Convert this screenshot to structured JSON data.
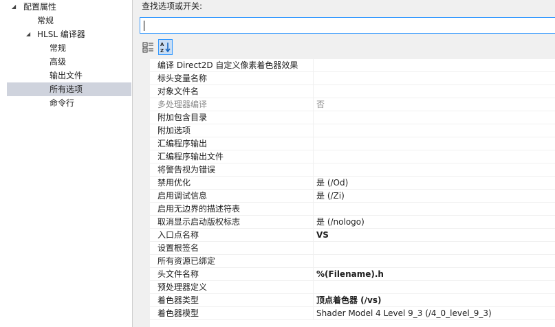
{
  "tree": {
    "items": [
      {
        "label": "配置属性",
        "arrow": "◢"
      },
      {
        "label": "常规"
      },
      {
        "label": "HLSL 编译器",
        "arrow": "◢"
      },
      {
        "label": "常规"
      },
      {
        "label": "高级"
      },
      {
        "label": "输出文件"
      },
      {
        "label": "所有选项",
        "selected": true
      },
      {
        "label": "命令行"
      }
    ]
  },
  "search": {
    "label": "查找选项或开关:",
    "value": ""
  },
  "toolbar": {
    "categorized_icon": "categorized-view-icon",
    "alphabetical_icon": "sort-alphabetical-icon"
  },
  "grid": {
    "rows": [
      {
        "name": "编译 Direct2D 自定义像素着色器效果",
        "value": ""
      },
      {
        "name": "标头变量名称",
        "value": ""
      },
      {
        "name": "对象文件名",
        "value": ""
      },
      {
        "name": "多处理器编译",
        "value": "否",
        "disabled": true
      },
      {
        "name": "附加包含目录",
        "value": ""
      },
      {
        "name": "附加选项",
        "value": ""
      },
      {
        "name": "汇编程序输出",
        "value": ""
      },
      {
        "name": "汇编程序输出文件",
        "value": ""
      },
      {
        "name": "将警告视为错误",
        "value": ""
      },
      {
        "name": "禁用优化",
        "value": "是 (/Od)"
      },
      {
        "name": "启用调试信息",
        "value": "是 (/Zi)"
      },
      {
        "name": "启用无边界的描述符表",
        "value": ""
      },
      {
        "name": "取消显示启动版权标志",
        "value": "是 (/nologo)"
      },
      {
        "name": "入口点名称",
        "value": "VS",
        "bold": true
      },
      {
        "name": "设置根签名",
        "value": ""
      },
      {
        "name": "所有资源已绑定",
        "value": ""
      },
      {
        "name": "头文件名称",
        "value": "%(Filename).h",
        "bold": true
      },
      {
        "name": "预处理器定义",
        "value": ""
      },
      {
        "name": "着色器类型",
        "value": "顶点着色器 (/vs)",
        "bold": true
      },
      {
        "name": "着色器模型",
        "value": "Shader Model 4 Level 9_3 (/4_0_level_9_3)"
      }
    ]
  }
}
